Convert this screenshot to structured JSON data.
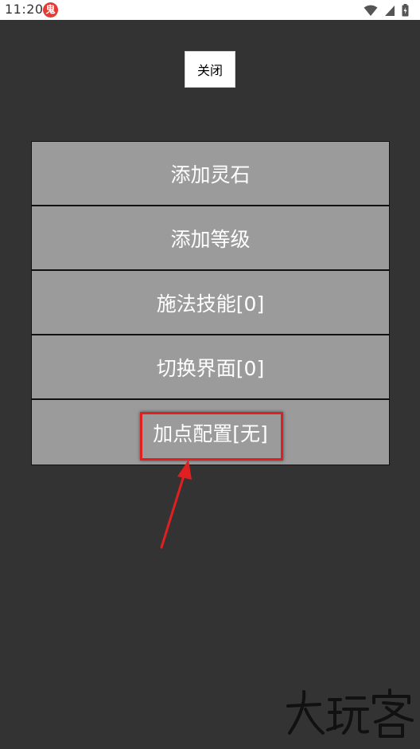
{
  "status_bar": {
    "time": "11:20",
    "app_icon_char": "鬼",
    "app_icon_color": "#e53935"
  },
  "dialog": {
    "close_label": "关闭",
    "menu_items": [
      {
        "label": "添加灵石"
      },
      {
        "label": "添加等级"
      },
      {
        "label": "施法技能[0]"
      },
      {
        "label": "切换界面[0]"
      },
      {
        "label": "加点配置[无]"
      }
    ],
    "highlighted_item_index": 4
  },
  "annotation": {
    "color": "#e02020"
  },
  "watermark": {
    "text": "大玩客"
  },
  "colors": {
    "background": "#333333",
    "menu_item_bg": "#9b9b9b",
    "menu_item_text": "#ffffff"
  }
}
